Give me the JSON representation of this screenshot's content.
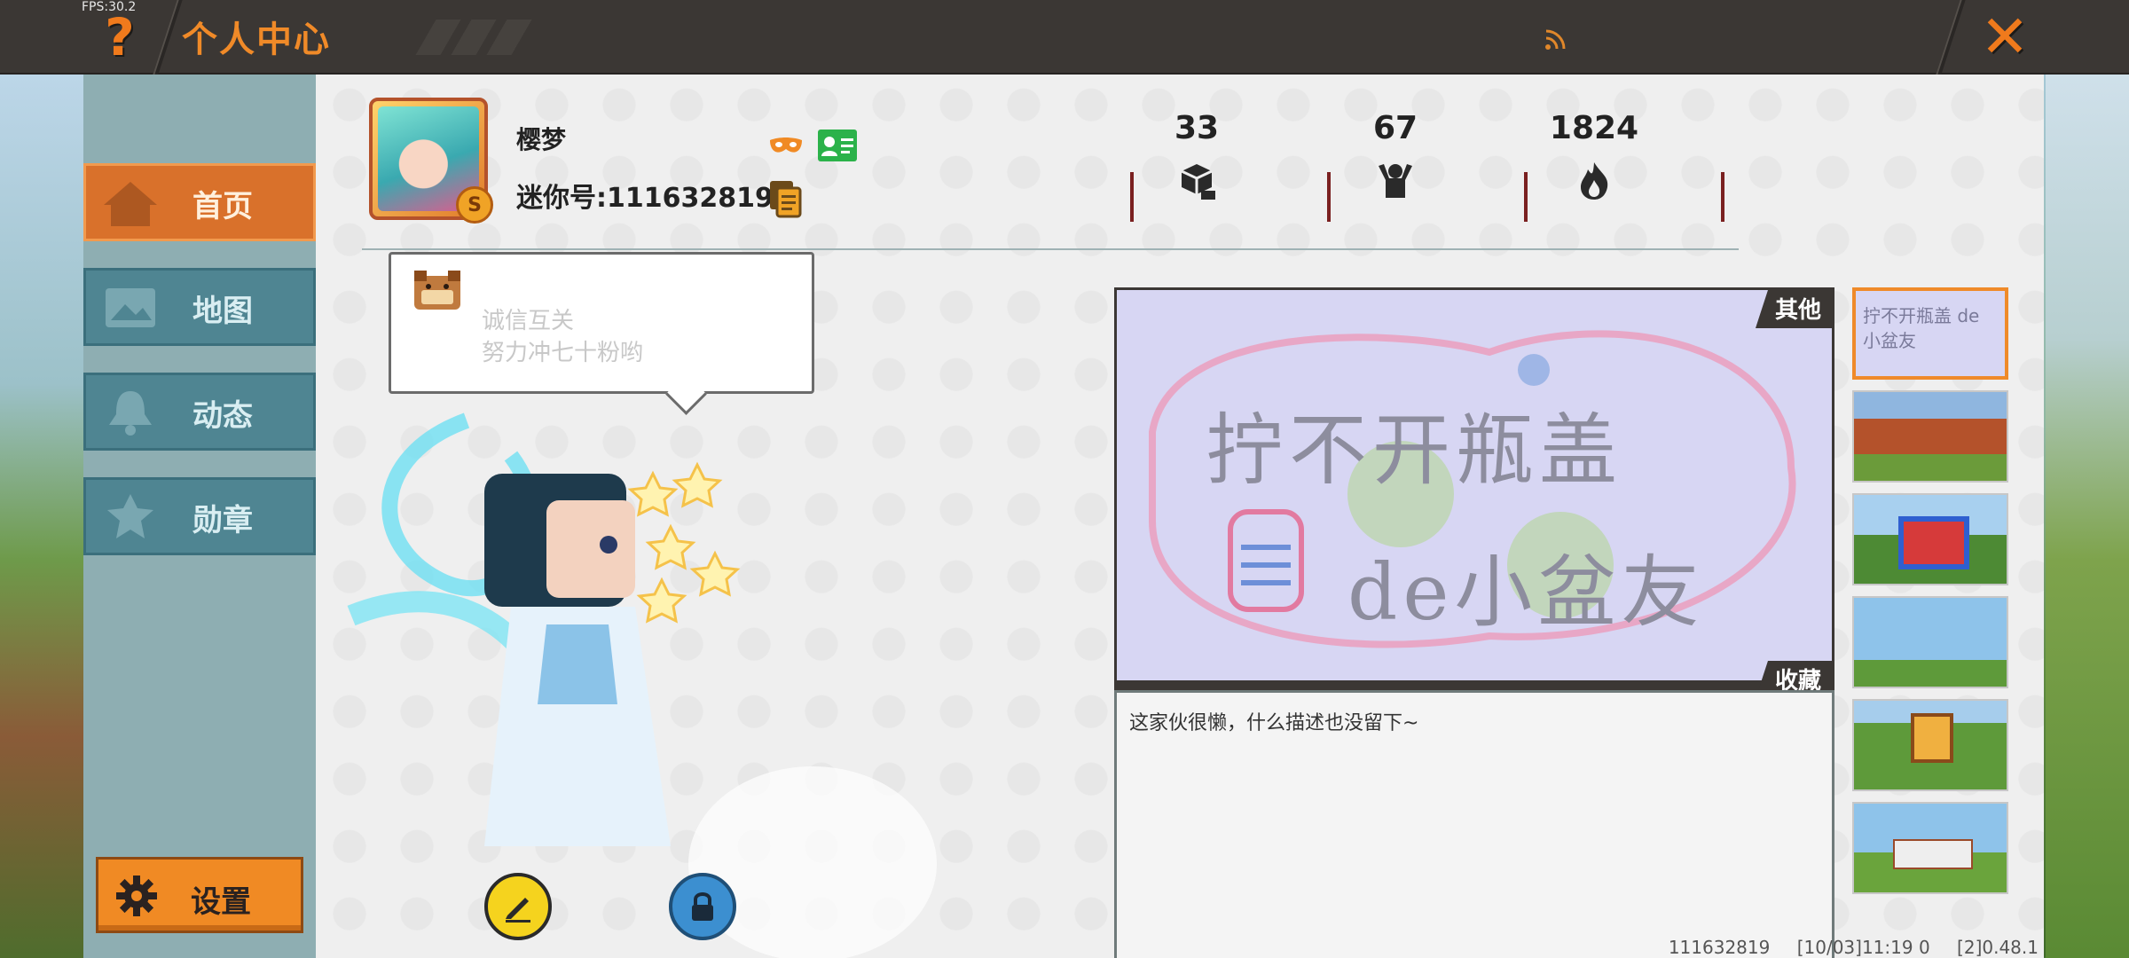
{
  "topbar": {
    "fps": "FPS:30.2",
    "help_icon": "question-icon",
    "title": "个人中心",
    "feed_icon": "rss-icon",
    "close_icon": "close-icon"
  },
  "sidebar": {
    "items": [
      {
        "label": "首页",
        "icon": "home-icon",
        "active": true
      },
      {
        "label": "地图",
        "icon": "map-icon",
        "active": false
      },
      {
        "label": "动态",
        "icon": "bell-icon",
        "active": false
      },
      {
        "label": "勋章",
        "icon": "medal-icon",
        "active": false
      }
    ],
    "settings_label": "设置"
  },
  "profile": {
    "nickname": "樱梦",
    "mini_id": "迷你号:111632819",
    "avatar_badge": "S"
  },
  "stats": [
    {
      "value": "33",
      "icon": "block-icon"
    },
    {
      "value": "67",
      "icon": "fans-icon"
    },
    {
      "value": "1824",
      "icon": "flame-icon"
    }
  ],
  "speech": {
    "line1": "诚信互关",
    "line2": "努力冲七十粉哟"
  },
  "showcase": {
    "tag_other": "其他",
    "tag_fav": "收藏",
    "image_text_line1": "拧不开瓶盖",
    "image_text_line2": "de小盆友",
    "description": "这家伙很懒，什么描述也没留下~"
  },
  "thumbnails": [
    {
      "caption": "拧不开瓶盖 de小盆友",
      "selected": true
    },
    {
      "caption": "",
      "selected": false
    },
    {
      "caption": "",
      "selected": false
    },
    {
      "caption": "",
      "selected": false
    },
    {
      "caption": "",
      "selected": false
    },
    {
      "caption": "",
      "selected": false
    }
  ],
  "footer": {
    "uid": "111632819",
    "timestamp": "[10/03]11:19 0",
    "version": "[2]0.48.1"
  },
  "colors": {
    "accent": "#f08a28",
    "topbar": "#3b3734",
    "nav": "#4f8592",
    "nav_active": "#d9712b"
  }
}
